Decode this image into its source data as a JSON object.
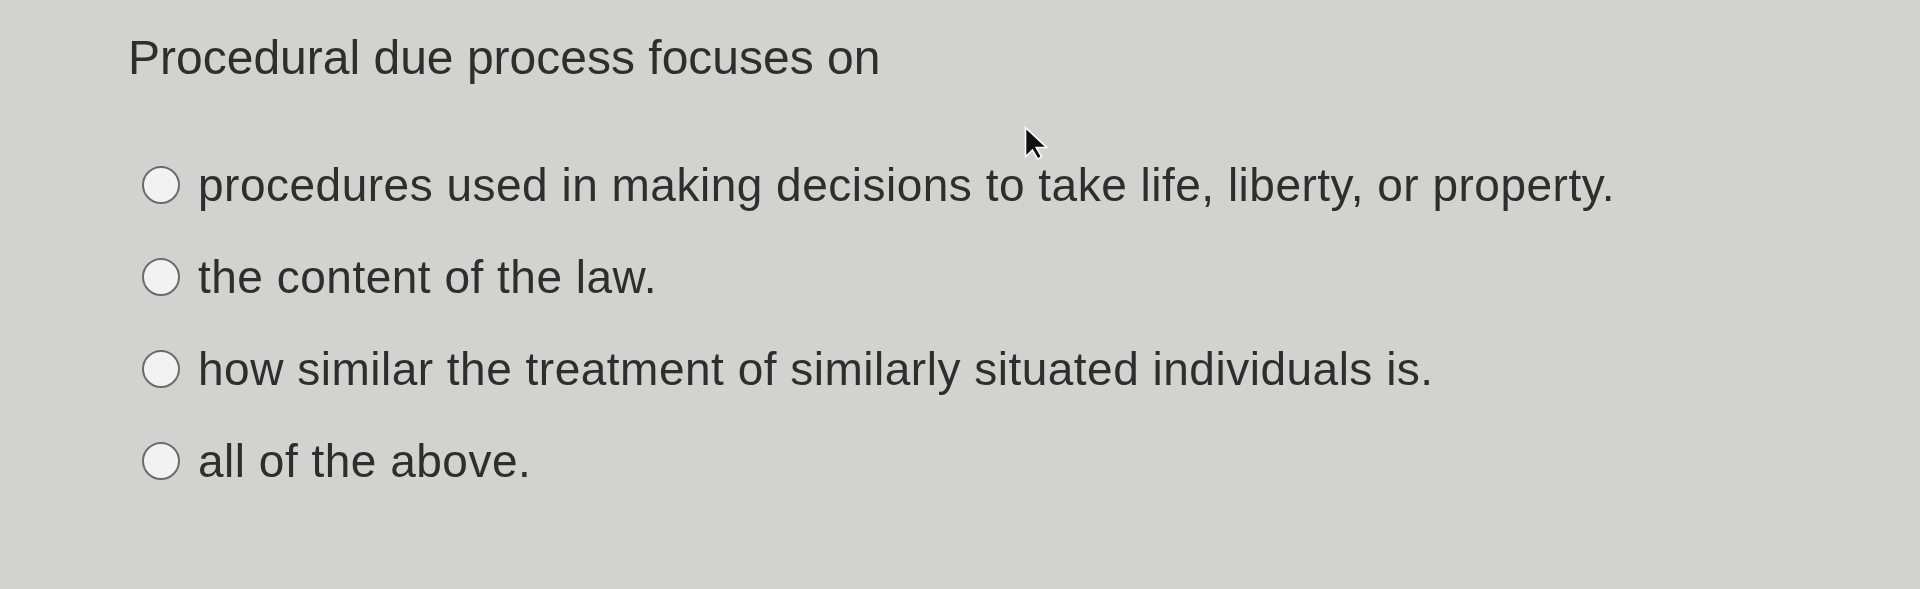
{
  "question": {
    "text": "Procedural due process focuses on"
  },
  "options": [
    {
      "label": "procedures used in making decisions to take life, liberty, or property.",
      "selected": false
    },
    {
      "label": "the content of the law.",
      "selected": false
    },
    {
      "label": "how similar the treatment of similarly situated individuals is.",
      "selected": false
    },
    {
      "label": "all of the above.",
      "selected": false
    }
  ]
}
